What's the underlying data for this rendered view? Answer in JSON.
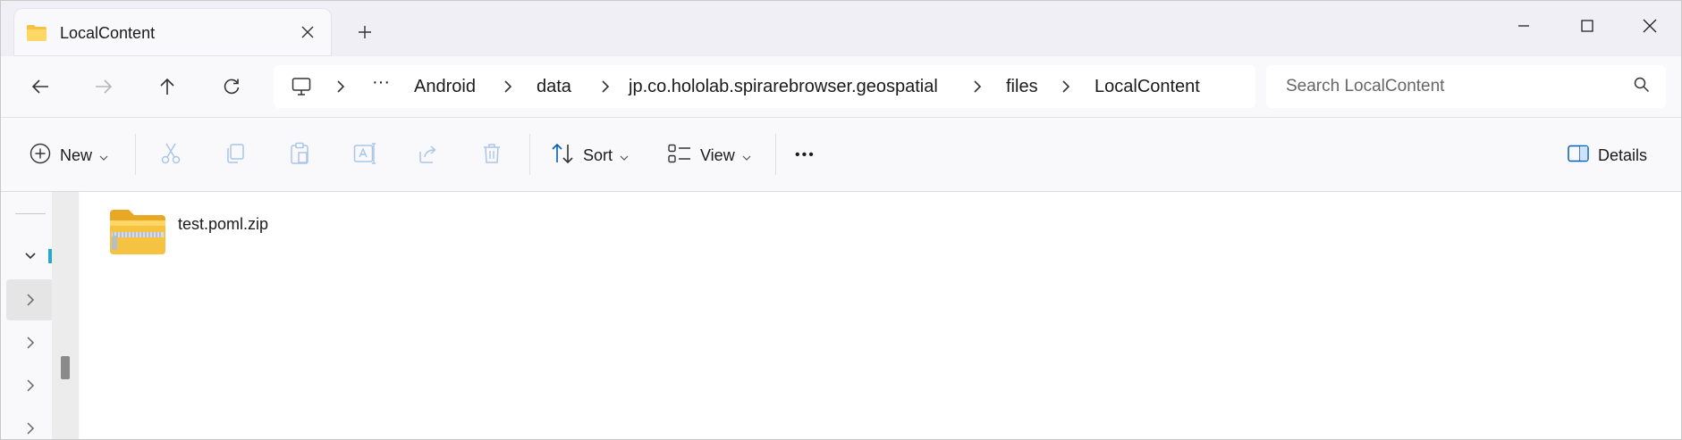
{
  "tab": {
    "title": "LocalContent",
    "close_icon": "close-icon",
    "new_tab_icon": "plus-icon"
  },
  "window_controls": {
    "minimize": "minimize-icon",
    "maximize": "maximize-icon",
    "close": "close-icon"
  },
  "nav": {
    "back": "arrow-left-icon",
    "forward": "arrow-right-icon",
    "up": "arrow-up-icon",
    "refresh": "refresh-icon"
  },
  "address": {
    "root_icon": "this-pc-icon",
    "overflow": "···",
    "crumbs": [
      "Android",
      "data",
      "jp.co.hololab.spirarebrowser.geospatial",
      "files",
      "LocalContent"
    ]
  },
  "search": {
    "placeholder": "Search LocalContent",
    "value": ""
  },
  "commands": {
    "new_label": "New",
    "sort_label": "Sort",
    "view_label": "View",
    "more_label": "•••",
    "details_label": "Details",
    "disabled": [
      "cut-icon",
      "copy-icon",
      "paste-icon",
      "rename-icon",
      "share-icon",
      "delete-icon"
    ]
  },
  "files": [
    {
      "name": "test.poml.zip",
      "icon": "zip-folder-icon"
    }
  ],
  "colors": {
    "folder": "#f5c242",
    "accent": "#005fb8",
    "disabled_icon": "#a9c6e8"
  }
}
